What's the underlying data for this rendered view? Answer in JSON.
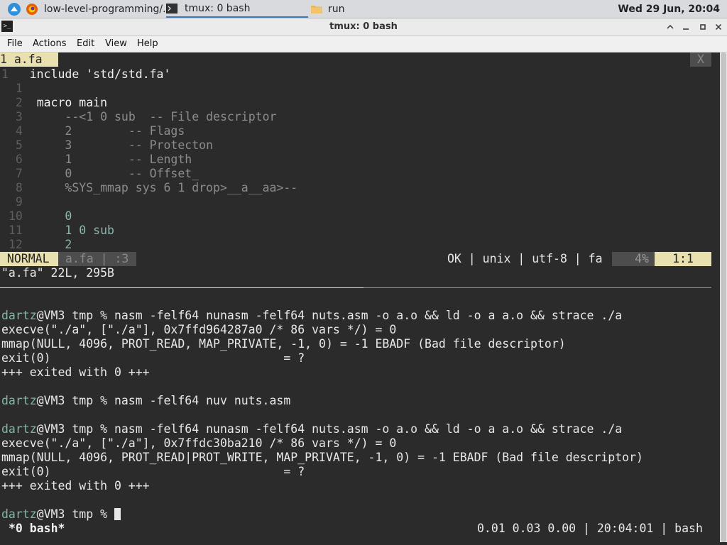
{
  "taskbar": {
    "app1_label": "low-level-programming/...",
    "app2_label": "tmux: 0 bash",
    "app3_label": "run",
    "clock": "Wed 29 Jun, 20:04"
  },
  "window": {
    "title": "tmux: 0 bash",
    "icon_text": ">_"
  },
  "menu": [
    "File",
    "Actions",
    "Edit",
    "View",
    "Help"
  ],
  "vim": {
    "tab_label": "1 a.fa",
    "close_label": "X",
    "lines": [
      {
        "num": "1",
        "text": "include 'std/std.fa'"
      },
      {
        "num": "1",
        "text": ""
      },
      {
        "num": "2",
        "text": "macro main"
      },
      {
        "num": "3",
        "text": "    --<1 0 sub  -- File descriptor"
      },
      {
        "num": "4",
        "text": "    2        -- Flags"
      },
      {
        "num": "5",
        "text": "    3        -- Protecton"
      },
      {
        "num": "6",
        "text": "    1        -- Length"
      },
      {
        "num": "7",
        "text": "    0        -- Offset_"
      },
      {
        "num": "8",
        "text": "    %SYS_mmap sys 6 1 drop>__a__aa>--"
      },
      {
        "num": "9",
        "text": ""
      },
      {
        "num": "10",
        "text": "    0"
      },
      {
        "num": "11",
        "text": "    1 0 sub"
      },
      {
        "num": "12",
        "text": "    2"
      }
    ],
    "status": {
      "mode": " NORMAL ",
      "file": " a.fa | :3 ",
      "info": "OK | unix | utf-8 | fa",
      "percent": "4%",
      "position": "1:1"
    },
    "message": "\"a.fa\" 22L, 295B"
  },
  "shell": {
    "lines": [
      {
        "user": "dartz",
        "rest": "@VM3 tmp % nasm -felf64 nunasm -felf64 nuts.asm -o a.o && ld -o a a.o && strace ./a"
      },
      {
        "user": "",
        "rest": "execve(\"./a\", [\"./a\"], 0x7ffd964287a0 /* 86 vars */) = 0"
      },
      {
        "user": "",
        "rest": "mmap(NULL, 4096, PROT_READ, MAP_PRIVATE, -1, 0) = -1 EBADF (Bad file descriptor)"
      },
      {
        "user": "",
        "rest": "exit(0)                                 = ?"
      },
      {
        "user": "",
        "rest": "+++ exited with 0 +++"
      },
      {
        "user": "",
        "rest": ""
      },
      {
        "user": "dartz",
        "rest": "@VM3 tmp % nasm -felf64 nuv nuts.asm"
      },
      {
        "user": "",
        "rest": ""
      },
      {
        "user": "dartz",
        "rest": "@VM3 tmp % nasm -felf64 nunasm -felf64 nuts.asm -o a.o && ld -o a a.o && strace ./a"
      },
      {
        "user": "",
        "rest": "execve(\"./a\", [\"./a\"], 0x7ffdc30ba210 /* 86 vars */) = 0"
      },
      {
        "user": "",
        "rest": "mmap(NULL, 4096, PROT_READ|PROT_WRITE, MAP_PRIVATE, -1, 0) = -1 EBADF (Bad file descriptor)"
      },
      {
        "user": "",
        "rest": "exit(0)                                 = ?"
      },
      {
        "user": "",
        "rest": "+++ exited with 0 +++"
      },
      {
        "user": "",
        "rest": ""
      },
      {
        "user": "dartz",
        "rest": "@VM3 tmp % "
      }
    ]
  },
  "tmux": {
    "window_label": "*0 bash*",
    "status_right": "0.01 0.03 0.00 | 20:04:01 | bash"
  },
  "colors": {
    "accent": "#3f77b8",
    "vim_highlight": "#e9e0b0",
    "prompt_user": "#7fb9a9",
    "terminal_bg": "#2b2b2b"
  }
}
